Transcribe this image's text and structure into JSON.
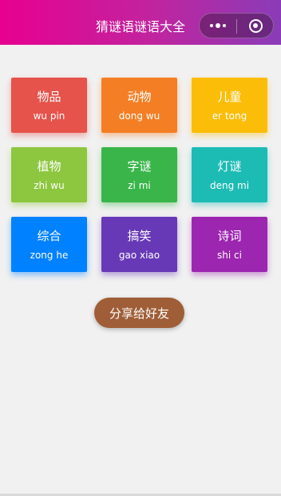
{
  "nav": {
    "title": "猜谜语谜语大全",
    "bg_gradient": [
      "#e80090",
      "#8a3cb8"
    ]
  },
  "categories": [
    {
      "zh": "物品",
      "pinyin": "wu pin",
      "color": "#e5534b",
      "shadow": "rgba(229,83,75,0.45)"
    },
    {
      "zh": "动物",
      "pinyin": "dong wu",
      "color": "#f47e24",
      "shadow": "rgba(244,126,36,0.45)"
    },
    {
      "zh": "儿童",
      "pinyin": "er tong",
      "color": "#fbbd08",
      "shadow": "rgba(251,189,8,0.45)"
    },
    {
      "zh": "植物",
      "pinyin": "zhi wu",
      "color": "#8dc63f",
      "shadow": "rgba(141,198,63,0.45)"
    },
    {
      "zh": "字谜",
      "pinyin": "zi mi",
      "color": "#39b54a",
      "shadow": "rgba(57,181,74,0.45)"
    },
    {
      "zh": "灯谜",
      "pinyin": "deng mi",
      "color": "#1cbbb4",
      "shadow": "rgba(28,187,180,0.45)"
    },
    {
      "zh": "综合",
      "pinyin": "zong he",
      "color": "#0081ff",
      "shadow": "rgba(0,129,255,0.45)"
    },
    {
      "zh": "搞笑",
      "pinyin": "gao xiao",
      "color": "#6739b6",
      "shadow": "rgba(103,57,182,0.45)"
    },
    {
      "zh": "诗词",
      "pinyin": "shi ci",
      "color": "#9c26b0",
      "shadow": "rgba(156,38,176,0.45)"
    }
  ],
  "share_button": {
    "label": "分享给好友",
    "color": "#9f5e37"
  },
  "icons": {
    "more": "more-dots-icon",
    "close": "target-circle-icon"
  }
}
